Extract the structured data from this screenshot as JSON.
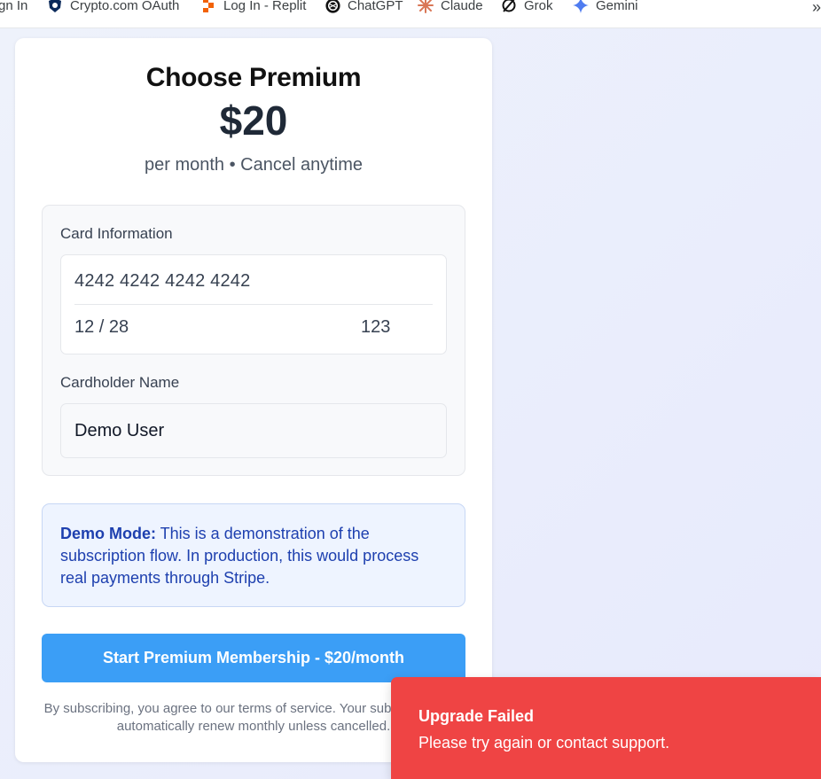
{
  "bookmarks": {
    "items": [
      {
        "label": "gn In",
        "icon": "none"
      },
      {
        "label": "Crypto.com OAuth",
        "icon": "shield-lion-icon"
      },
      {
        "label": "Log In - Replit",
        "icon": "replit-icon"
      },
      {
        "label": "ChatGPT",
        "icon": "openai-icon"
      },
      {
        "label": "Claude",
        "icon": "claude-burst-icon"
      },
      {
        "label": "Grok",
        "icon": "grok-icon"
      },
      {
        "label": "Gemini",
        "icon": "gemini-sparkle-icon"
      }
    ],
    "overflow": "»"
  },
  "checkout": {
    "title": "Choose Premium",
    "price": "$20",
    "price_sub": "per month • Cancel anytime",
    "card_info_label": "Card Information",
    "card_number": "4242 4242 4242 4242",
    "card_expiry": "12 / 28",
    "card_cvc": "123",
    "cardholder_label": "Cardholder Name",
    "cardholder_value": "Demo User",
    "notice_bold": "Demo Mode:",
    "notice_text": " This is a demonstration of the subscription flow. In production, this would process real payments through Stripe.",
    "cta_label": "Start Premium Membership - $20/month",
    "terms_text": "By subscribing, you agree to our terms of service. Your subscription will automatically renew monthly unless cancelled."
  },
  "toast": {
    "title": "Upgrade Failed",
    "message": "Please try again or contact support."
  },
  "colors": {
    "cta": "#3b9ef6",
    "toast": "#ef4444",
    "notice_text": "#1e40af"
  }
}
